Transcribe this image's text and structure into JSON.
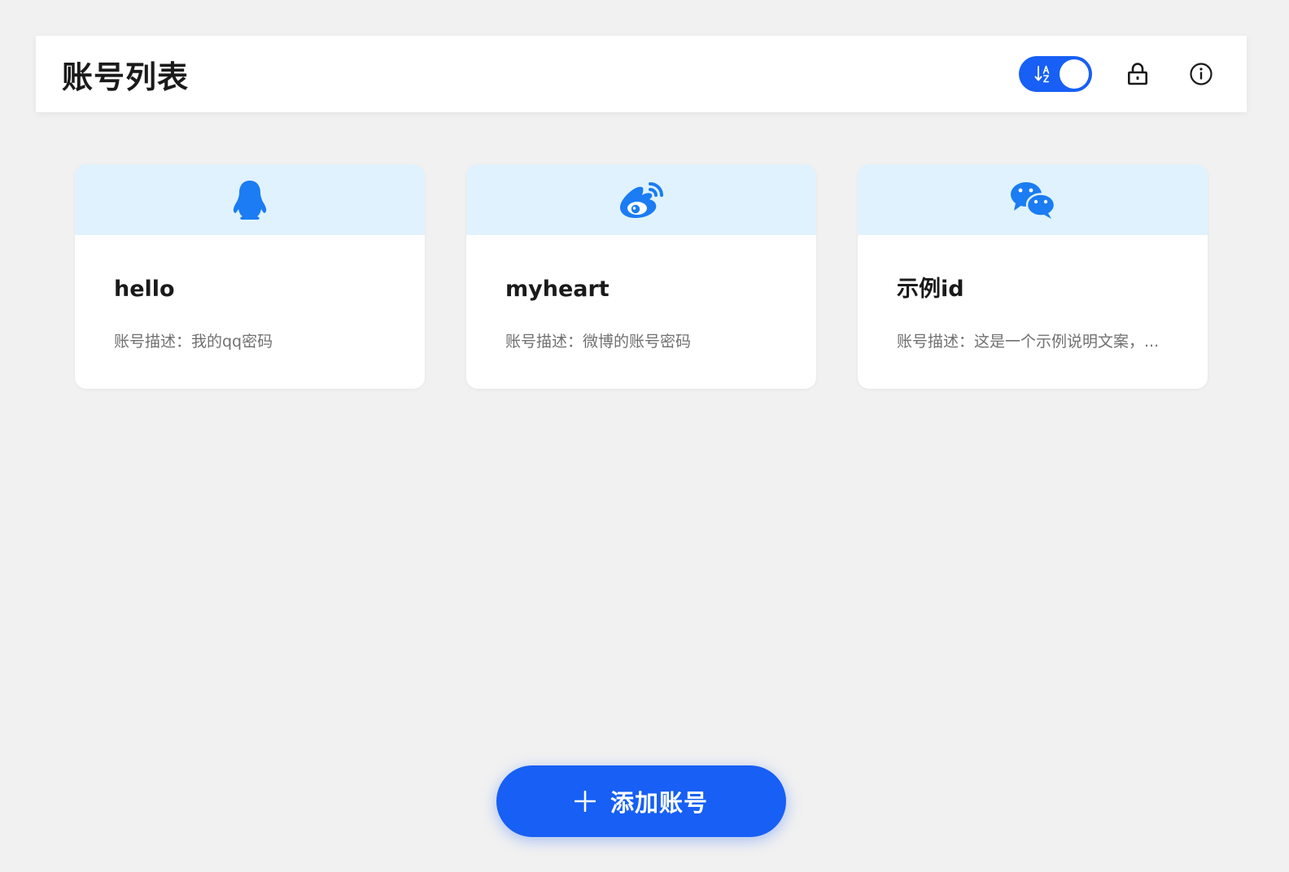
{
  "header": {
    "title": "账号列表",
    "sort_toggle": {
      "icon": "sort-az-icon",
      "enabled": true
    },
    "lock_icon": "lock-icon",
    "info_icon": "info-icon"
  },
  "accounts": [
    {
      "icon": "qq-penguin-icon",
      "name": "hello",
      "description": "账号描述：我的qq密码"
    },
    {
      "icon": "weibo-icon",
      "name": "myheart",
      "description": "账号描述：微博的账号密码"
    },
    {
      "icon": "wechat-icon",
      "name": "示例id",
      "description": "账号描述：这是一个示例说明文案，..."
    }
  ],
  "add_button": {
    "icon": "plus-icon",
    "label": "添加账号"
  },
  "colors": {
    "accent": "#175ff5",
    "icon_blue": "#1b7cf3",
    "card_header_bg": "#e0f2fd",
    "page_bg": "#f1f1f1"
  }
}
